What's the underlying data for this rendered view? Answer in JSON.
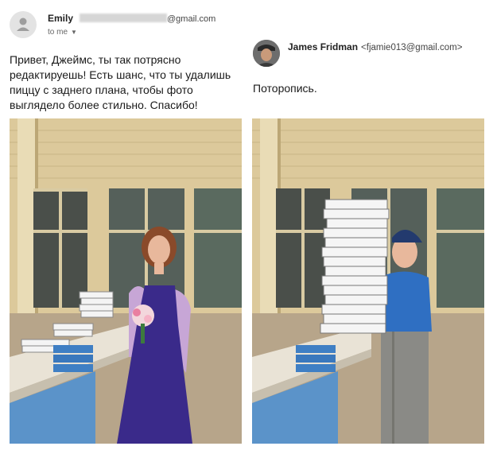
{
  "emily": {
    "name": "Emily",
    "email_domain": "@gmail.com",
    "recipient_label": "to me",
    "message": "Привет, Джеймс, ты так потрясно редактируешь! Есть шанс, что ты удалишь пиццу с заднего плана, чтобы фото выглядело более стильно. Спасибо!"
  },
  "james": {
    "name": "James Fridman",
    "email": "<fjamie013@gmail.com>",
    "message": "Поторопись."
  },
  "icons": {
    "emily_avatar": "person-avatar-icon",
    "recipient_dropdown": "chevron-down-icon"
  },
  "colors": {
    "wall": "#d9c79a",
    "dress": "#3a2a8a",
    "tablecloth": "#5b93c9",
    "shirt": "#2f6fc2"
  }
}
